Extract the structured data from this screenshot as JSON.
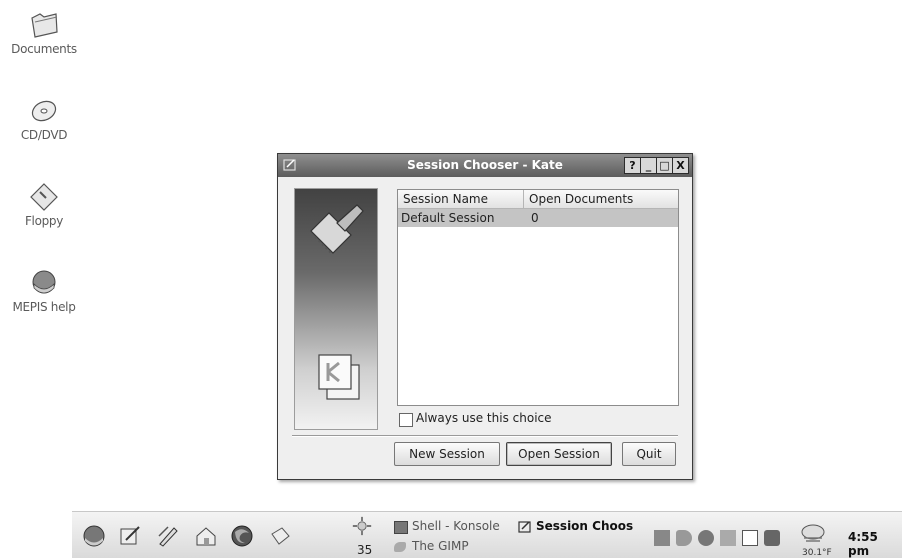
{
  "desktop": {
    "icons": [
      {
        "label": "Documents",
        "icon": "folder-icon"
      },
      {
        "label": "CD/DVD",
        "icon": "cd-dvd-icon"
      },
      {
        "label": "Floppy",
        "icon": "floppy-icon"
      },
      {
        "label": "MEPIS help",
        "icon": "help-lifebuoy-icon"
      }
    ]
  },
  "dialog": {
    "title": "Session Chooser - Kate",
    "titlebar_buttons": [
      "?",
      "_",
      "□",
      "X"
    ],
    "list": {
      "columns": [
        "Session Name",
        "Open Documents"
      ],
      "rows": [
        {
          "name": "Default Session",
          "docs": "0",
          "selected": true
        }
      ]
    },
    "checkbox": {
      "label": "Always use this choice",
      "checked": false
    },
    "buttons": {
      "new": "New Session",
      "open": "Open Session",
      "quit": "Quit"
    }
  },
  "taskbar": {
    "launchers": [
      "kmenu-icon",
      "kate-icon",
      "konsole-pen-icon",
      "home-icon",
      "firefox-icon",
      "kpager-icon"
    ],
    "weather_count": "35",
    "tasks": [
      {
        "label": "Shell - Konsole",
        "active": false
      },
      {
        "label": "The GIMP",
        "active": false
      },
      {
        "label": "Session Choos",
        "active": true
      }
    ],
    "tray": [
      "network-icon",
      "volume-icon",
      "kmix-icon",
      "klipper-icon",
      "display-icon",
      "printer-icon"
    ],
    "temperature": "30.1°F",
    "clock": "4:55 pm"
  }
}
